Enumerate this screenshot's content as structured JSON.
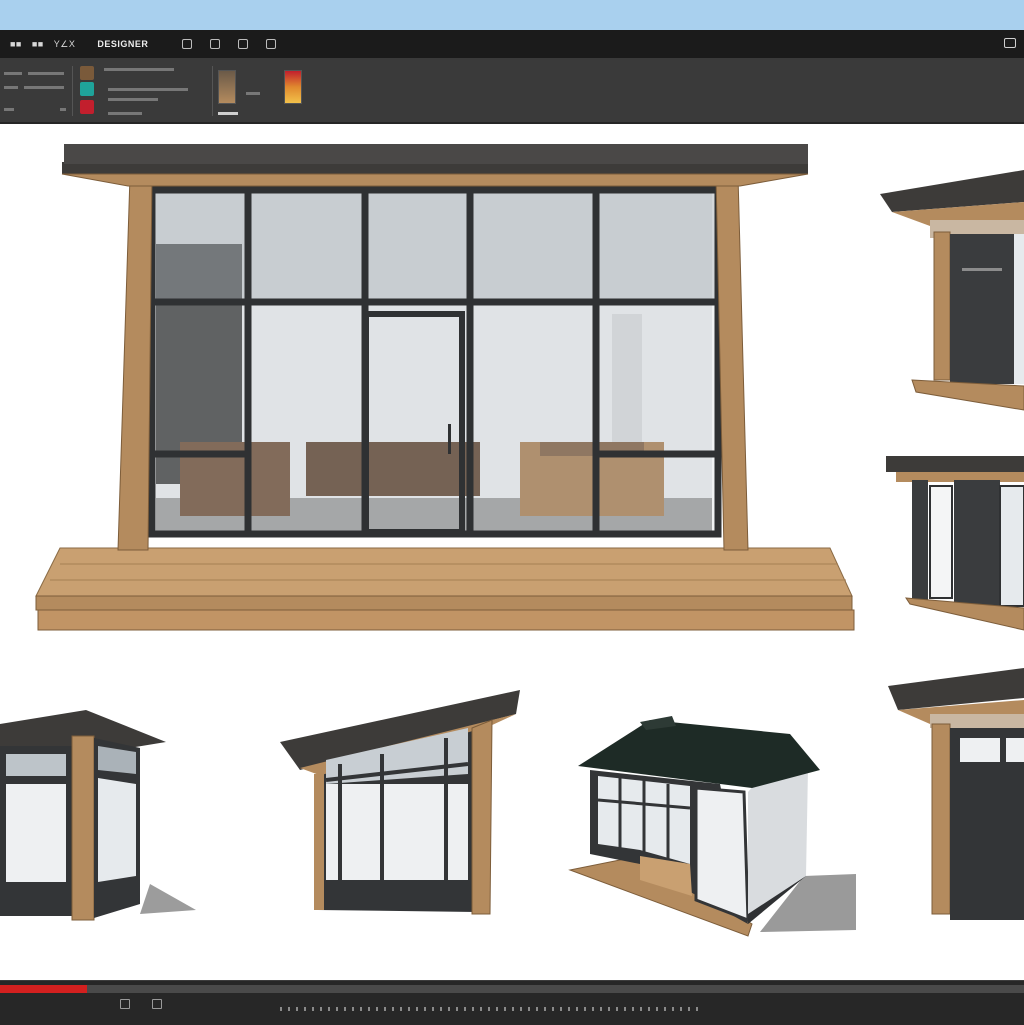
{
  "menubar": {
    "items": [
      "■■",
      "■■",
      "Y∠X"
    ],
    "title": "DESIGNER"
  },
  "timeline": {
    "progress": 0.085
  },
  "colors": {
    "sky": "#a9d0ee",
    "menubar": "#1b1b1b",
    "toolbar": "#3a3a3a",
    "wood": "#b48b5e",
    "frame": "#333537",
    "roof": "#3d3b39",
    "glass": "#e6eaed",
    "accent_red": "#d3201f"
  },
  "icons": [
    "square-icon",
    "copy-icon",
    "layers-icon",
    "frame-icon",
    "maximize-icon"
  ]
}
